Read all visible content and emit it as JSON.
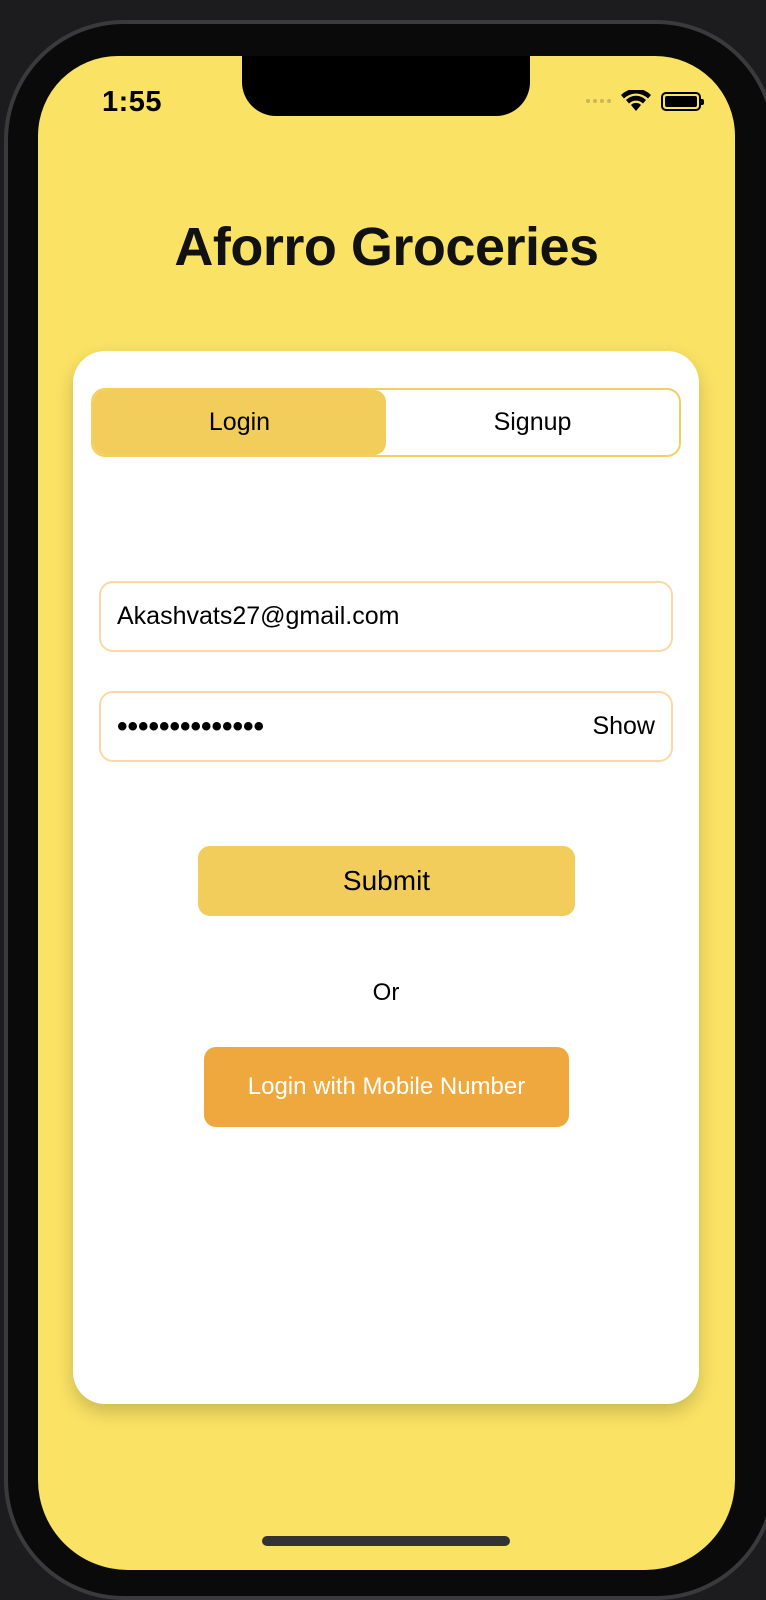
{
  "status_bar": {
    "time": "1:55",
    "icons": [
      "cellular-signal-icon",
      "wifi-icon",
      "battery-icon"
    ]
  },
  "app": {
    "title": "Aforro Groceries"
  },
  "tabs": [
    {
      "label": "Login",
      "active": true
    },
    {
      "label": "Signup",
      "active": false
    }
  ],
  "form": {
    "email_value": "Akashvats27@gmail.com",
    "password_masked": "••••••••••••••",
    "show_label": "Show",
    "submit_label": "Submit",
    "or_text": "Or",
    "mobile_login_label": "Login with Mobile Number"
  },
  "colors": {
    "background": "#f9e264",
    "accent": "#f2cd5c",
    "mobile_button": "#efa83d",
    "field_border": "#fbd9a6"
  }
}
